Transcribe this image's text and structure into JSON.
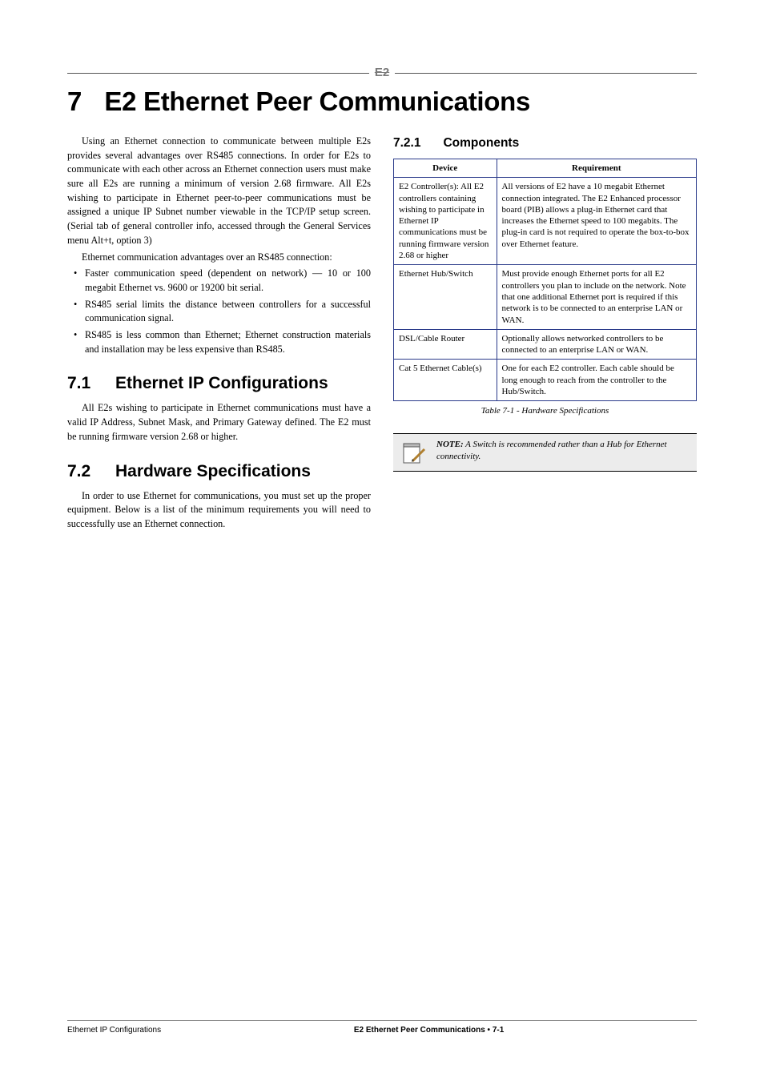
{
  "top_logo": "E2",
  "chapter": {
    "number": "7",
    "title": "E2 Ethernet Peer Communications"
  },
  "left": {
    "intro_p1": "Using an Ethernet connection to communicate between multiple E2s provides several advantages over RS485 connections. In order for E2s to communicate with each other across an Ethernet connection users must make sure all E2s are running a minimum of version 2.68 firmware. All E2s wishing to participate in Ethernet peer-to-peer communications must be assigned a unique IP Subnet number viewable in the TCP/IP setup screen. (Serial tab of general controller info, accessed through the General Services menu Alt+t, option 3)",
    "intro_p2": "Ethernet communication advantages over an RS485 connection:",
    "bullets": [
      "Faster communication speed (dependent on network) — 10 or 100 megabit Ethernet vs. 9600 or 19200 bit serial.",
      "RS485 serial limits the distance between controllers for a successful communication signal.",
      "RS485 is less common than Ethernet; Ethernet construction materials and installation may be less expensive than RS485."
    ],
    "sections": [
      {
        "num": "7.1",
        "title": "Ethernet IP Configura­tions",
        "para": "All E2s wishing to participate in Ethernet communications must have a valid IP Address, Subnet Mask, and Primary Gateway defined. The E2 must be running firmware version 2.68 or higher."
      },
      {
        "num": "7.2",
        "title": "Hardware Specifica­tions",
        "para": "In order to use Ethernet for communications, you must set up the proper equipment. Below is a list of the minimum requirements you will need to successfully use an Ethernet connection."
      }
    ]
  },
  "right": {
    "subsec": {
      "num": "7.2.1",
      "title": "Components"
    },
    "table": {
      "headers": [
        "Device",
        "Requirement"
      ],
      "rows": [
        [
          "E2 Controller(s): All E2 controllers containing wishing to participate in Ethernet IP communications must be running firmware version 2.68 or higher",
          "All versions of E2 have a 10 megabit Ethernet connection integrated. The E2 Enhanced processor board (PIB) allows a plug-in Ethernet card that increases the Ethernet speed to 100 megabits. The plug-in card is not required to operate the box-to-box over Ethernet feature."
        ],
        [
          "Ethernet Hub/Switch",
          "Must provide enough Ethernet ports for all E2 controllers you plan to include on the network. Note that one additional Ethernet port is required if this network is to be connected to an enterprise LAN or WAN."
        ],
        [
          "DSL/Cable Router",
          "Optionally allows networked controllers to be connected to an enterprise LAN or WAN."
        ],
        [
          "Cat 5 Ethernet Cable(s)",
          "One for each E2 controller. Each cable should be long enough to reach from the controller to the Hub/Switch."
        ]
      ],
      "caption": "Table 7-1 - Hardware Specifications"
    },
    "note": {
      "label": "NOTE:",
      "text": "A Switch is recommended rather than a Hub for Ethernet connectivity."
    }
  },
  "footer": {
    "left": "Ethernet IP Configurations",
    "center": "E2 Ethernet Peer Communications • 7-1",
    "right": ""
  }
}
